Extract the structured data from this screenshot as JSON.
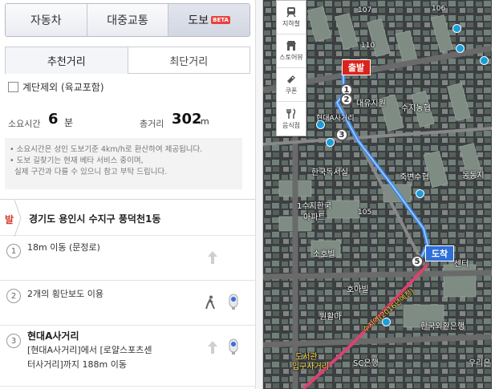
{
  "mode_tabs": [
    {
      "label": "자동차"
    },
    {
      "label": "대중교통"
    },
    {
      "label": "도보",
      "badge": "BETA"
    }
  ],
  "sub_tabs": [
    {
      "label": "추천거리"
    },
    {
      "label": "최단거리"
    }
  ],
  "options": {
    "stairs_label": "계단제외 (육교포함)"
  },
  "summary": {
    "time_label": "소요시간",
    "time_value": "6",
    "time_unit": "분",
    "distance_label": "총거리",
    "distance_value": "302",
    "distance_unit": "m"
  },
  "notice": {
    "line1": "• 소요시간은 성인 도보기준 4km/h로 환산하여 제공됩니다.",
    "line2": "• 도보 길찾기는 현재 베타 서비스 중이며,",
    "line3": "실제 구간과 다를 수 있으니 참고 부탁 드립니다."
  },
  "start": {
    "tag": "발",
    "address": "경기도 용인시 수지구 풍덕천1동"
  },
  "steps": [
    {
      "num": "1",
      "text": "18m 이동 (문정로)"
    },
    {
      "num": "2",
      "text": "2개의 횡단보도 이용"
    },
    {
      "num": "3",
      "title": "현대A사거리",
      "line1": "[현대A사거리]에서 [로얄스포츠센",
      "line2": "터사거리]까지 188m 이동"
    }
  ],
  "map": {
    "tools": [
      {
        "label": "지하철",
        "icon": "subway-icon"
      },
      {
        "label": "스토어뷰",
        "icon": "store-icon"
      },
      {
        "label": "쿠폰",
        "icon": "coupon-icon"
      },
      {
        "label": "음식점",
        "icon": "restaurant-icon"
      }
    ],
    "start_marker": "출발",
    "end_marker": "도착",
    "route_points": [
      "1",
      "2",
      "3",
      "5"
    ],
    "labels": {
      "l107": "107",
      "l106": "106",
      "l110": "110",
      "daeyu": "대유지원",
      "suji_nonghyup": "수지농협",
      "hyundai_a": "현대A사거리",
      "hanguk_seosil": "한국독서실",
      "jukbyeon": "죽변수협",
      "suji_apt1": "1수지한국",
      "suji_apt2": "아파트",
      "l105": "105",
      "sohobil": "소호빌",
      "hoabil": "호아빌",
      "wonhwal": "원활마",
      "suji_station": "수지역(2016년예정)",
      "hanguk_bank": "한국외환은행",
      "library1": "도서관",
      "library2": "입구사거리",
      "sc_bank": "SC은행",
      "woori": "우리은",
      "dongdong": "동동지",
      "center": "센터"
    }
  }
}
